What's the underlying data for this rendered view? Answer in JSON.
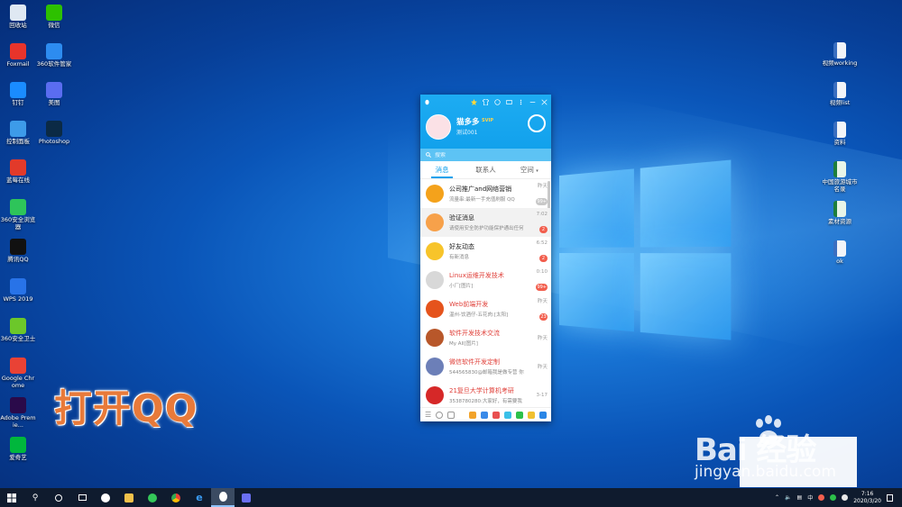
{
  "desktop": {
    "left_icons": [
      {
        "label": "回收站",
        "icon": "recycle-bin-icon",
        "color": "#dfe8f2"
      },
      {
        "label": "微信",
        "icon": "wechat-icon",
        "color": "#2dc100"
      },
      {
        "label": "Foxmail",
        "icon": "foxmail-icon",
        "color": "#e8342b"
      },
      {
        "label": "360软件管家",
        "icon": "software-manager-icon",
        "color": "#2d8cf0"
      },
      {
        "label": "钉钉",
        "icon": "dingtalk-icon",
        "color": "#1a8cff"
      },
      {
        "label": "美图",
        "icon": "app-icon",
        "color": "#5a6df0"
      },
      {
        "label": "控制面板",
        "icon": "control-panel-icon",
        "color": "#3d9be9"
      },
      {
        "label": "Photoshop",
        "icon": "photoshop-icon",
        "color": "#0b2a45"
      },
      {
        "label": "蓝莓在线",
        "icon": "browser-icon",
        "color": "#e23a2a"
      },
      {
        "label": "360安全浏览器",
        "icon": "360-browser-icon",
        "color": "#2ec45a"
      },
      {
        "label": "腾讯QQ",
        "icon": "qq-icon",
        "color": "#111111"
      },
      {
        "label": "WPS 2019",
        "icon": "wps-icon",
        "color": "#2873e8"
      },
      {
        "label": "360安全卫士",
        "icon": "360-safe-icon",
        "color": "#6cc72a"
      },
      {
        "label": "Google Chrome",
        "icon": "chrome-icon",
        "color": "#e94235"
      },
      {
        "label": "Adobe Premie...",
        "icon": "premiere-icon",
        "color": "#2a0a4a"
      },
      {
        "label": "爱奇艺",
        "icon": "iqiyi-icon",
        "color": "#00b73c"
      }
    ],
    "right_icons": [
      {
        "label": "视频working",
        "icon": "file-icon"
      },
      {
        "label": "视频list",
        "icon": "file-icon"
      },
      {
        "label": "资料",
        "icon": "file-icon"
      },
      {
        "label": "中国旅游城市名录",
        "icon": "excel-file-icon"
      },
      {
        "label": "素材资源",
        "icon": "excel-file-icon"
      },
      {
        "label": "ok",
        "icon": "file-icon"
      }
    ],
    "overlay_title": "打开QQ"
  },
  "qq": {
    "nickname": "猫多多",
    "svip": "SVIP",
    "signature": "测试001",
    "search_placeholder": "搜索",
    "tabs": [
      "消息",
      "联系人",
      "空间"
    ],
    "conversations": [
      {
        "name": "公司推广and网络营销",
        "preview": "流量串:最新一手充值刷服 QQ",
        "time": "昨天",
        "badge": "99+",
        "badge_grey": true,
        "red": false,
        "color": "#f4a21b"
      },
      {
        "name": "验证消息",
        "preview": "请使用安全防护功能保护通出任何",
        "time": "7:02",
        "badge": "2",
        "badge_grey": false,
        "red": false,
        "color": "#f7a14a"
      },
      {
        "name": "好友动态",
        "preview": "有新消息",
        "time": "6:52",
        "badge": "2",
        "badge_grey": false,
        "red": false,
        "color": "#f7c42a"
      },
      {
        "name": "Linux运维开发技术",
        "preview": "小厂[图片]",
        "time": "0:10",
        "badge": "99+",
        "badge_grey": false,
        "red": true,
        "color": "#d8d8d8"
      },
      {
        "name": "Web前端开发",
        "preview": "温州-饮酒仔-五花肉:[太阳]",
        "time": "昨天",
        "badge": "23",
        "badge_grey": false,
        "red": true,
        "color": "#e5531c"
      },
      {
        "name": "软件开发技术交流",
        "preview": "My All[图片]",
        "time": "昨天",
        "badge": "",
        "badge_grey": false,
        "red": true,
        "color": "#b8572a"
      },
      {
        "name": "微信软件开发定制",
        "preview": "544565830@邮箱我是做专营 你",
        "time": "昨天",
        "badge": "",
        "badge_grey": false,
        "red": true,
        "color": "#6c7fb8"
      },
      {
        "name": "21复旦大学计算机考研",
        "preview": "3538780280:大家好，有需要我",
        "time": "3-17",
        "badge": "",
        "badge_grey": false,
        "red": true,
        "color": "#d62828"
      }
    ]
  },
  "taskbar": {
    "ime": "中",
    "time": "7:16",
    "date": "2020/3/20"
  },
  "watermark": {
    "brand": "Bai 经验",
    "url": "jingyan.baidu.com"
  },
  "colors": {
    "qq_blue": "#12a1ec",
    "badge_red": "#f25f4e",
    "title_orange": "#e87a3a"
  }
}
